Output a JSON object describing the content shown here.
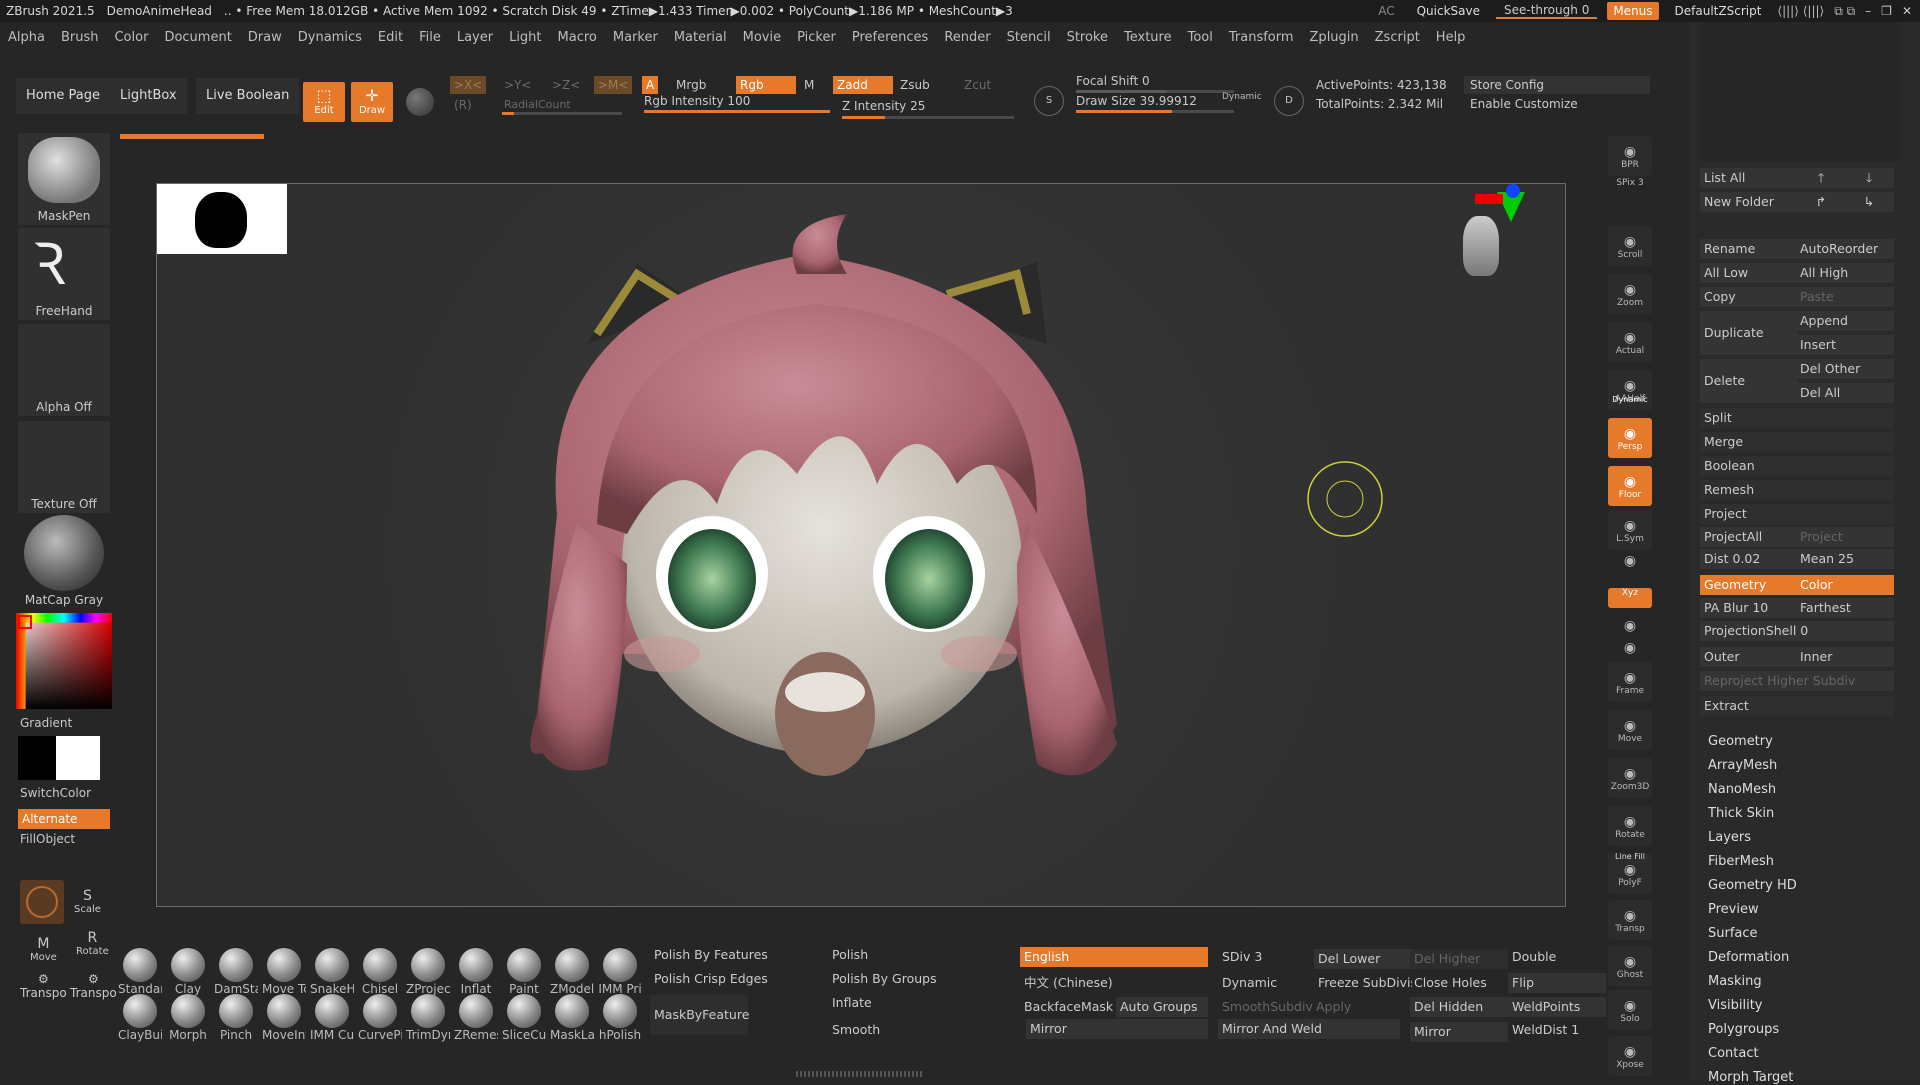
{
  "titlebar": {
    "app": "ZBrush 2021.5",
    "doc": "DemoAnimeHead",
    "stats": ".. • Free Mem 18.012GB • Active Mem 1092 • Scratch Disk 49 • ZTime▶1.433 Timer▶0.002 • PolyCount▶1.186 MP • MeshCount▶3",
    "ac": "AC",
    "quicksave": "QuickSave",
    "seethrough": "See-through",
    "seethrough_value": "0",
    "menus": "Menus",
    "script": "DefaultZScript"
  },
  "menubar": [
    "Alpha",
    "Brush",
    "Color",
    "Document",
    "Draw",
    "Dynamics",
    "Edit",
    "File",
    "Layer",
    "Light",
    "Macro",
    "Marker",
    "Material",
    "Movie",
    "Picker",
    "Preferences",
    "Render",
    "Stencil",
    "Stroke",
    "Texture",
    "Tool",
    "Transform",
    "Zplugin",
    "Zscript",
    "Help"
  ],
  "shelf": {
    "home": "Home Page",
    "lightbox": "LightBox",
    "liveboolean": "Live Boolean",
    "edit": "Edit",
    "draw": "Draw",
    "x": ">X<",
    "y": ">Y<",
    "z": ">Z<",
    "r": "(R)",
    "m": ">M<",
    "radialcount": "RadialCount",
    "a": "A",
    "mrgb": "Mrgb",
    "rgb": "Rgb",
    "mm": "M",
    "zadd": "Zadd",
    "zsub": "Zsub",
    "zcut": "Zcut",
    "rgb_intensity": "Rgb Intensity 100",
    "z_intensity": "Z Intensity 25",
    "rgb_intensity_value": 1.0,
    "z_intensity_value": 0.25,
    "focal_shift": "Focal Shift 0",
    "draw_size": "Draw Size 39.99912",
    "dynamic": "Dynamic",
    "active_points": "ActivePoints: 423,138",
    "total_points": "TotalPoints: 2.342 Mil",
    "store_config": "Store Config",
    "enable_customize": "Enable Customize"
  },
  "lefttray": {
    "brush": "MaskPen",
    "stroke": "FreeHand",
    "alpha": "Alpha Off",
    "texture": "Texture Off",
    "material": "MatCap Gray",
    "gradient": "Gradient",
    "switchcolor": "SwitchColor",
    "alternate": "Alternate",
    "fillobject": "FillObject",
    "scale": "Scale",
    "move": "Move",
    "rotate": "Rotate",
    "transpose1": "Transpo",
    "transpose2": "Transpo"
  },
  "rightbar": [
    "BPR",
    "SPix 3",
    "Scroll",
    "Zoom",
    "Actual",
    "AAHalf",
    "Persp",
    "Floor",
    "L.Sym",
    "",
    "Xyz",
    "",
    "",
    "Frame",
    "Move",
    "Zoom3D",
    "Rotate",
    "PolyF",
    "Transp",
    "Ghost",
    "Solo",
    "Xpose"
  ],
  "rightbar_labels": {
    "dynamic": "Dynamic",
    "linefill": "Line Fill"
  },
  "rpanel": {
    "list_all": "List All",
    "new_folder": "New Folder",
    "rename": "Rename",
    "autoreorder": "AutoReorder",
    "all_low": "All Low",
    "all_high": "All High",
    "copy": "Copy",
    "paste": "Paste",
    "duplicate": "Duplicate",
    "append": "Append",
    "insert": "Insert",
    "delete": "Delete",
    "del_other": "Del Other",
    "del_all": "Del All",
    "split": "Split",
    "merge": "Merge",
    "boolean": "Boolean",
    "remesh": "Remesh",
    "project": "Project",
    "projectall": "ProjectAll",
    "project_history": "Project History",
    "dist": "Dist 0.02",
    "mean": "Mean 25",
    "geometry": "Geometry",
    "color": "Color",
    "pa_blur": "PA Blur 10",
    "farthest": "Farthest",
    "projection_shell": "ProjectionShell 0",
    "outer": "Outer",
    "inner": "Inner",
    "reproject": "Reproject Higher Subdiv",
    "extract": "Extract",
    "sections": [
      "Geometry",
      "ArrayMesh",
      "NanoMesh",
      "Thick Skin",
      "Layers",
      "FiberMesh",
      "Geometry HD",
      "Preview",
      "Surface",
      "Deformation",
      "Masking",
      "Visibility",
      "Polygroups",
      "Contact",
      "Morph Target"
    ]
  },
  "brushes_row1": [
    "Standar",
    "Clay",
    "DamSta",
    "Move Tc",
    "SnakeHc",
    "Chisel",
    "ZProject",
    "Inflat",
    "Paint",
    "ZModel",
    "IMM Pri"
  ],
  "brushes_row2": [
    "ClayBuil",
    "Morph",
    "Pinch",
    "MoveInf",
    "IMM Cu",
    "CurvePi",
    "TrimDyr",
    "ZRemes",
    "SliceCur",
    "MaskLa",
    "hPolish"
  ],
  "bottom": {
    "polish_by_features": "Polish By Features",
    "polish_crisp_edges": "Polish Crisp Edges",
    "maskbyfeature": "MaskByFeature",
    "polish": "Polish",
    "polish_by_groups": "Polish By Groups",
    "inflate": "Inflate",
    "smooth": "Smooth",
    "english": "English",
    "chinese": "中文 (Chinese)",
    "backfacemask": "BackfaceMask",
    "auto_groups": "Auto Groups",
    "mirror": "Mirror",
    "sdiv": "SDiv 3",
    "dynamic": "Dynamic",
    "smoothsubdiv": "SmoothSubdiv",
    "apply": "Apply",
    "mirror_weld": "Mirror And Weld",
    "del_lower": "Del Lower",
    "del_higher": "Del Higher",
    "freeze": "Freeze SubDivision Levels",
    "close_holes": "Close Holes",
    "del_hidden": "Del Hidden",
    "mirror2": "Mirror",
    "double": "Double",
    "flip": "Flip",
    "weldpoints": "WeldPoints",
    "welddist": "WeldDist 1"
  }
}
